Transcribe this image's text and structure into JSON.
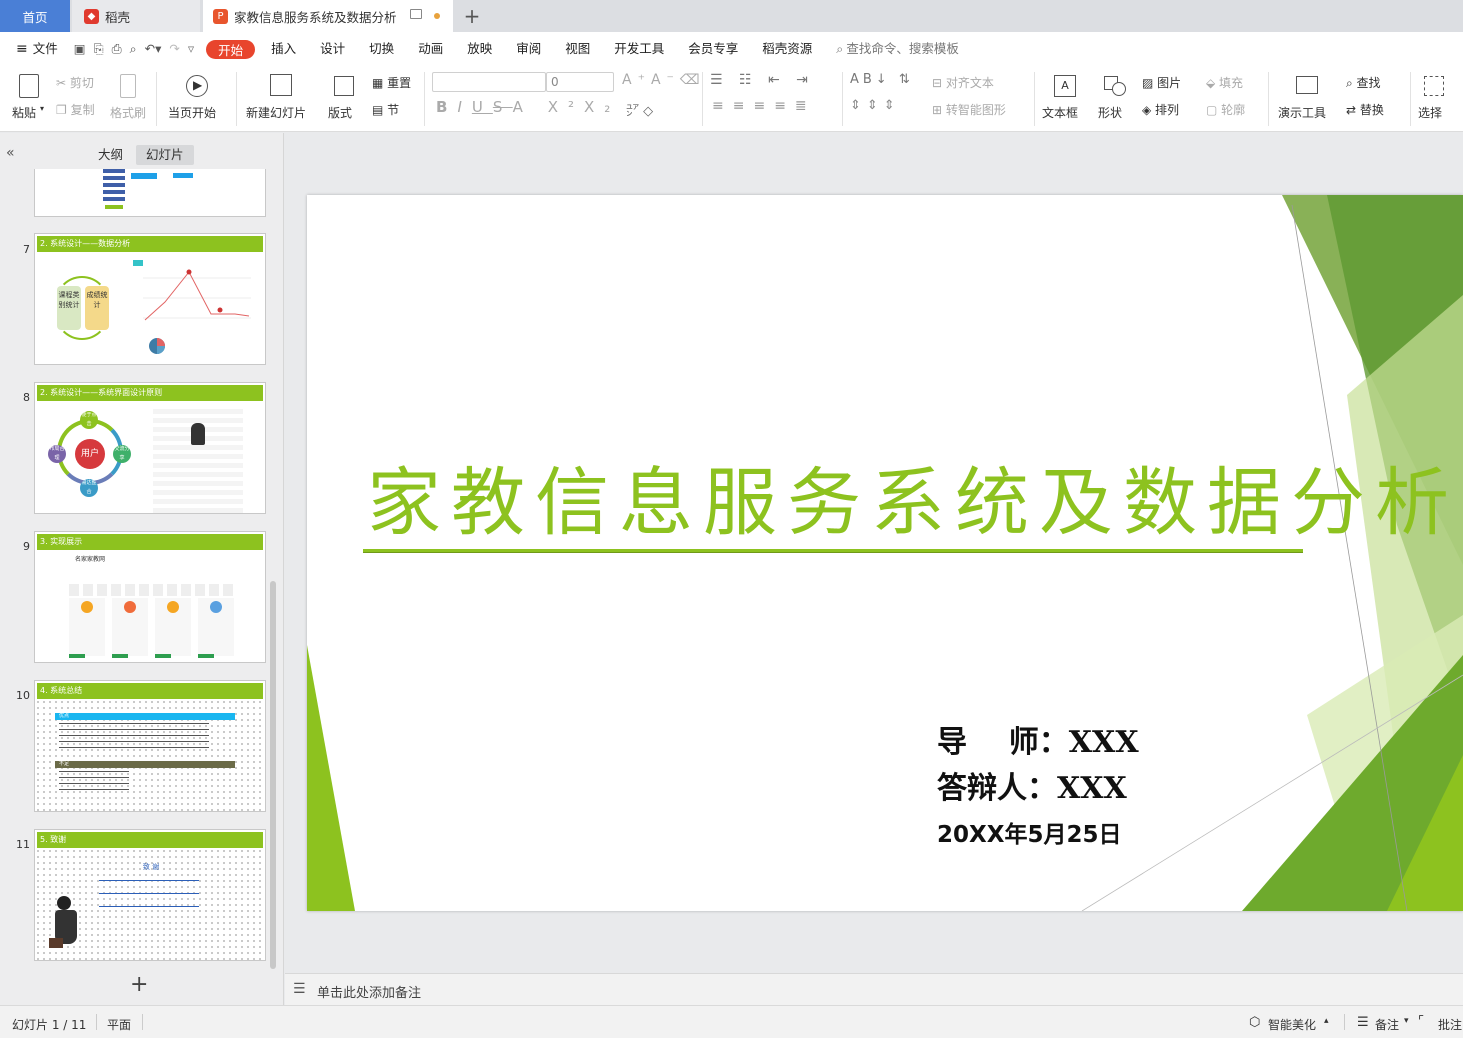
{
  "tabs": {
    "home": "首页",
    "daoke": "稻壳",
    "doc": "家教信息服务系统及数据分析",
    "new_tab": "+"
  },
  "menu": {
    "file": "文件",
    "items": [
      "开始",
      "插入",
      "设计",
      "切换",
      "动画",
      "放映",
      "审阅",
      "视图",
      "开发工具",
      "会员专享",
      "稻壳资源"
    ],
    "search_placeholder": "查找命令、搜索模板"
  },
  "ribbon": {
    "paste": "粘贴",
    "cut": "剪切",
    "copy": "复制",
    "format_painter": "格式刷",
    "from_current": "当页开始",
    "new_slide": "新建幻灯片",
    "layout": "版式",
    "reset": "重置",
    "section": "节",
    "font_size": "0",
    "align_text": "对齐文本",
    "smart_shape": "转智能图形",
    "textbox": "文本框",
    "shape": "形状",
    "picture": "图片",
    "arrange": "排列",
    "fill": "填充",
    "outline": "轮廓",
    "present_tools": "演示工具",
    "find": "查找",
    "replace": "替换",
    "select": "选择"
  },
  "panel": {
    "outline_tab": "大纲",
    "slides_tab": "幻灯片",
    "add": "+"
  },
  "thumbnails": [
    {
      "num": "7",
      "title": "2. 系统设计——数据分析",
      "left_box": "课程类别统计",
      "right_box": "成绩统计"
    },
    {
      "num": "8",
      "title": "2. 系统设计——系统界面设计原则",
      "center": "用户",
      "n1": "便于点击",
      "n2": "交流分享",
      "n3": "易达整合",
      "n4": "布局合理"
    },
    {
      "num": "9",
      "title": "3. 实现展示",
      "site": "名家家教网"
    },
    {
      "num": "10",
      "title": "4. 系统总结",
      "bar1": "优点",
      "bar2": "不足"
    },
    {
      "num": "11",
      "title": "5. 致谢",
      "heading": "致 谢"
    }
  ],
  "slide": {
    "title": "家教信息服务系统及数据分析",
    "advisor": "导    师：XXX",
    "defender": "答辩人：XXX",
    "date": "20XX年5月25日"
  },
  "notes": {
    "placeholder": "单击此处添加备注"
  },
  "status": {
    "slide_count": "幻灯片 1 / 11",
    "theme": "平面",
    "smart_beautify": "智能美化",
    "notes": "备注",
    "comments": "批注"
  },
  "colors": {
    "accent_green": "#8dc21f",
    "menu_active": "#e8452d",
    "home_tab": "#4a7fd6"
  }
}
